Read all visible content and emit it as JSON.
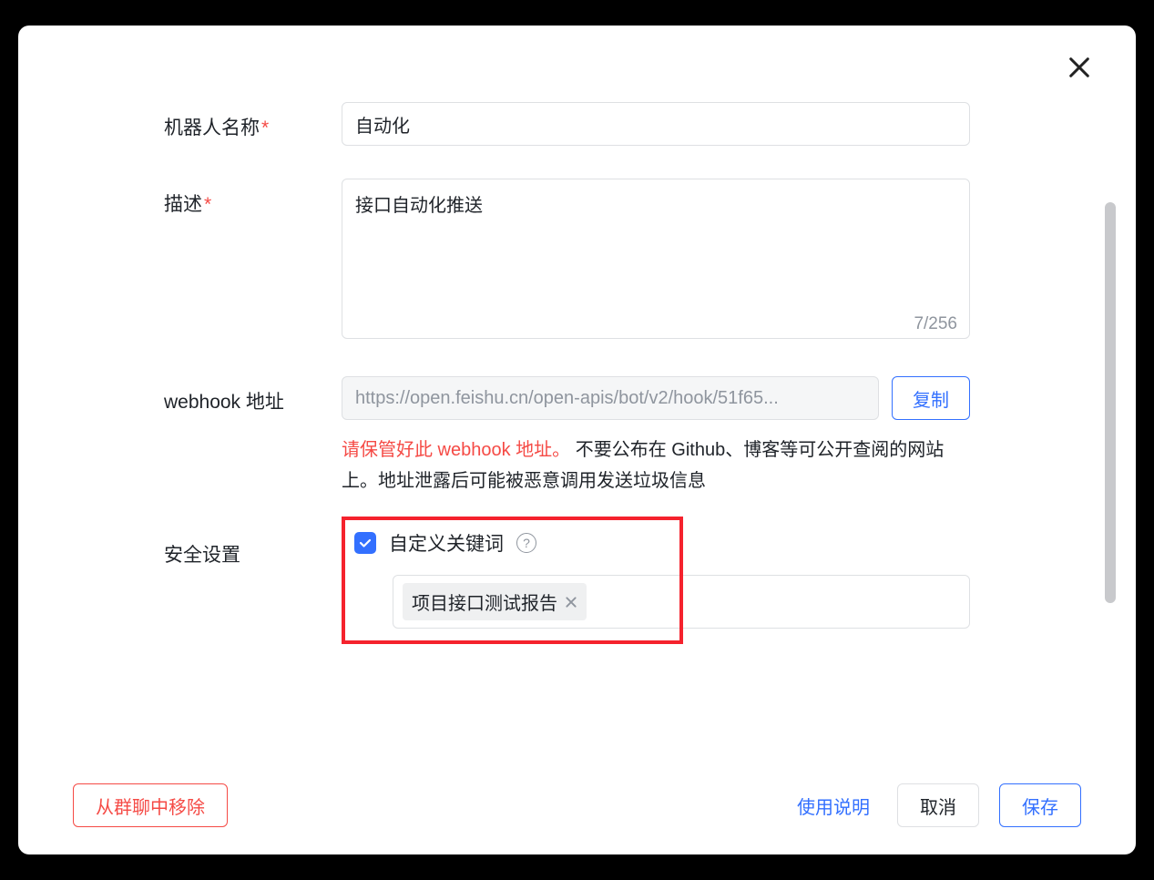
{
  "labels": {
    "bot_name": "机器人名称",
    "description": "描述",
    "webhook": "webhook 地址",
    "security": "安全设置"
  },
  "fields": {
    "bot_name_value": "自动化",
    "description_value": "接口自动化推送",
    "description_counter": "7/256",
    "webhook_value": "https://open.feishu.cn/open-apis/bot/v2/hook/51f65...",
    "copy_label": "复制"
  },
  "webhook_warning": {
    "red": "请保管好此 webhook 地址。",
    "rest": " 不要公布在 Github、博客等可公开查阅的网站上。地址泄露后可能被恶意调用发送垃圾信息"
  },
  "security": {
    "custom_keyword_label": "自定义关键词",
    "tag_text": "项目接口测试报告"
  },
  "footer": {
    "remove": "从群聊中移除",
    "usage": "使用说明",
    "cancel": "取消",
    "save": "保存"
  }
}
